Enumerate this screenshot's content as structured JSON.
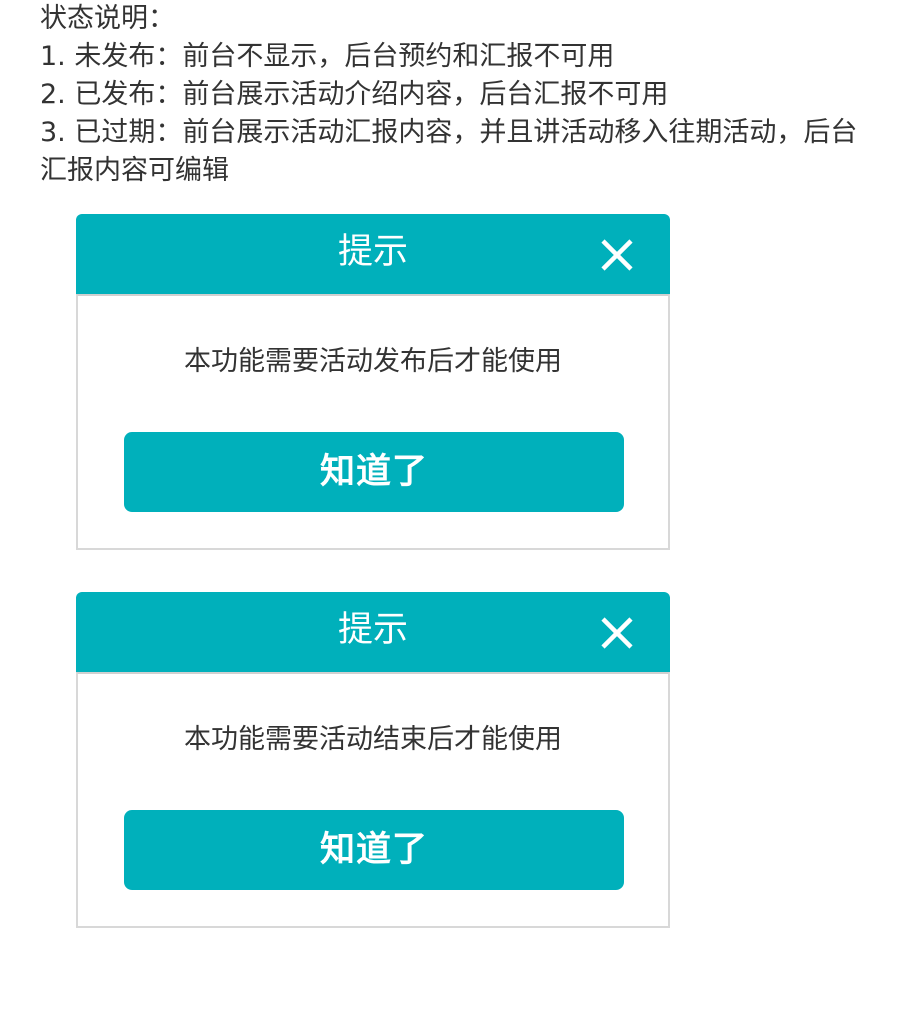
{
  "notes": {
    "heading": "状态说明：",
    "items": [
      "1. 未发布：前台不显示，后台预约和汇报不可用",
      "2. 已发布：前台展示活动介绍内容，后台汇报不可用",
      "3. 已过期：前台展示活动汇报内容，并且讲活动移入往期活动，后台汇报内容可编辑"
    ]
  },
  "dialogs": [
    {
      "title": "提示",
      "message": "本功能需要活动发布后才能使用",
      "button_label": "知道了",
      "close_icon": "close-icon"
    },
    {
      "title": "提示",
      "message": "本功能需要活动结束后才能使用",
      "button_label": "知道了",
      "close_icon": "close-icon"
    }
  ],
  "colors": {
    "accent": "#00b0bb",
    "text": "#333333",
    "border": "#d8d8d8"
  }
}
